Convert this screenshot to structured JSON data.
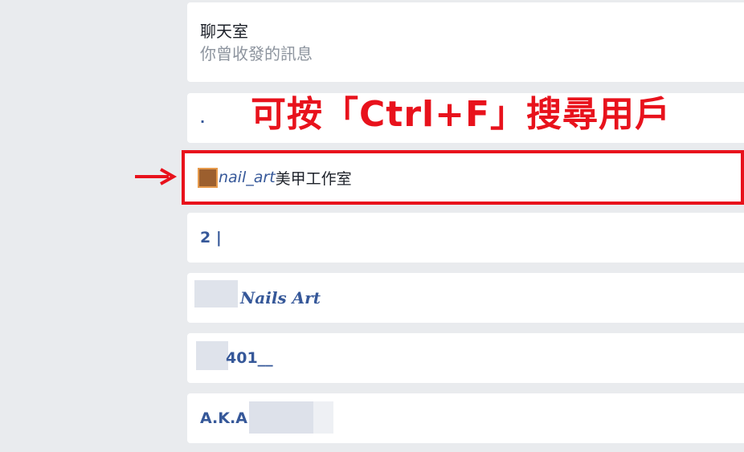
{
  "header": {
    "title": "聊天室",
    "subtitle": "你曾收發的訊息"
  },
  "annotation": {
    "text": "可按「Ctrl+F」搜尋用戶",
    "color": "#e8121c"
  },
  "results": [
    {
      "label": "."
    },
    {
      "label_prefix": "nail_art",
      "label_suffix": "美甲工作室"
    },
    {
      "label": "2 |"
    },
    {
      "label": "Nails Art"
    },
    {
      "label": "401__"
    },
    {
      "label": "A.K.A"
    }
  ],
  "colors": {
    "background": "#e9ebee",
    "card": "#ffffff",
    "link": "#365899",
    "highlight_border": "#e8121c"
  }
}
